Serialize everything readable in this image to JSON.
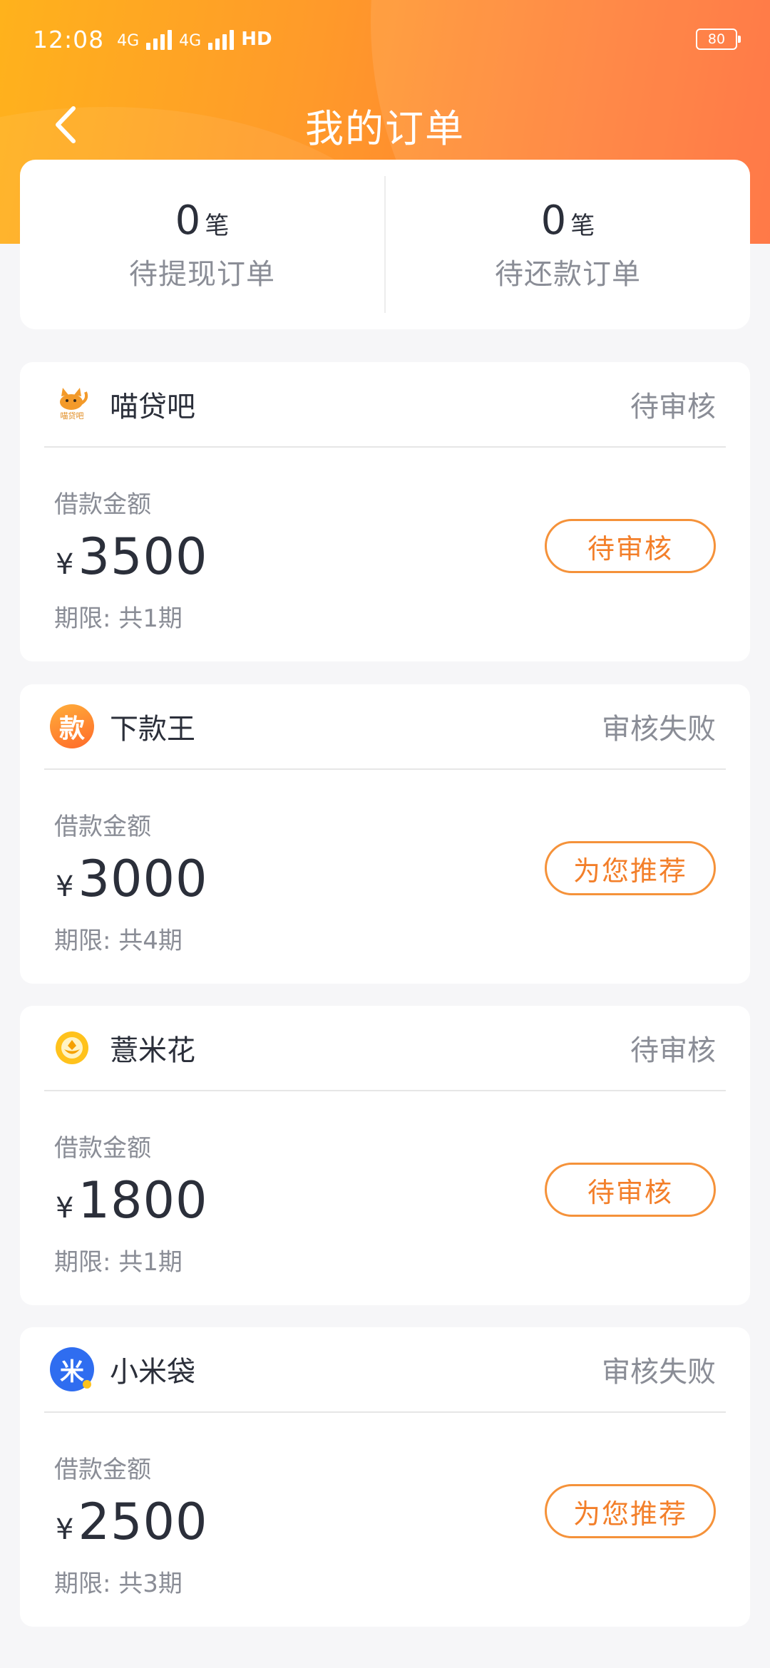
{
  "status_bar": {
    "time": "12:08",
    "signal_1": "4G",
    "signal_2": "4G",
    "hd": "HD",
    "battery": "80"
  },
  "nav": {
    "title": "我的订单"
  },
  "summary": {
    "left": {
      "count": "0",
      "unit": "笔",
      "label": "待提现订单"
    },
    "right": {
      "count": "0",
      "unit": "笔",
      "label": "待还款订单"
    }
  },
  "orders": [
    {
      "brand": "喵贷吧",
      "logo_icon": "cat-logo-icon",
      "logo_caption": "喵贷吧",
      "status": "待审核",
      "amount_label": "借款金额",
      "currency": "¥",
      "amount": "3500",
      "term": "期限: 共1期",
      "action": "待审核"
    },
    {
      "brand": "下款王",
      "logo_icon": "kuan-logo-icon",
      "logo_char": "款",
      "status": "审核失败",
      "amount_label": "借款金额",
      "currency": "¥",
      "amount": "3000",
      "term": "期限: 共4期",
      "action": "为您推荐"
    },
    {
      "brand": "薏米花",
      "logo_icon": "yellow-coin-logo-icon",
      "status": "待审核",
      "amount_label": "借款金额",
      "currency": "¥",
      "amount": "1800",
      "term": "期限: 共1期",
      "action": "待审核"
    },
    {
      "brand": "小米袋",
      "logo_icon": "mi-logo-icon",
      "logo_char": "米",
      "status": "审核失败",
      "amount_label": "借款金额",
      "currency": "¥",
      "amount": "2500",
      "term": "期限: 共3期",
      "action": "为您推荐"
    }
  ],
  "colors": {
    "header_start": "#ffb21c",
    "header_end": "#ff6a34",
    "accent": "#f37f2a",
    "muted_text": "#8a8d96",
    "primary_text": "#2b2f3a",
    "page_bg": "#f6f6f8"
  }
}
